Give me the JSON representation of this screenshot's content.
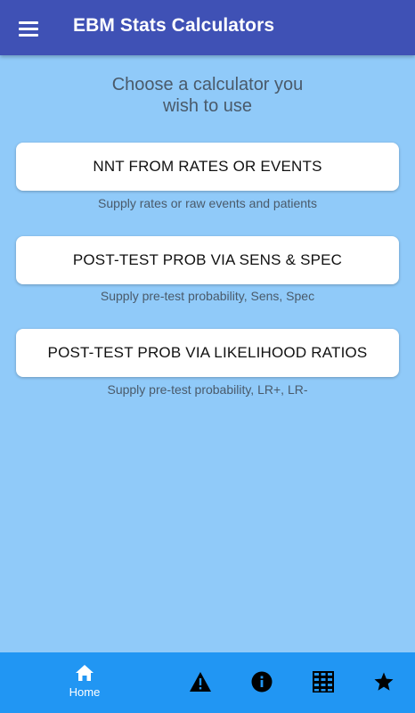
{
  "app_bar": {
    "title": "EBM Stats Calculators",
    "menu_icon": "hamburger-menu-icon",
    "background": "#3F51B5"
  },
  "main": {
    "background": "#90CAF9",
    "prompt_line1": "Choose a calculator you",
    "prompt_line2": "wish to use",
    "calculators": [
      {
        "label": "NNT FROM RATES OR EVENTS",
        "description": "Supply rates or raw events and patients"
      },
      {
        "label": "POST-TEST PROB VIA SENS & SPEC",
        "description": "Supply pre-test probability, Sens, Spec"
      },
      {
        "label": "POST-TEST PROB VIA LIKELIHOOD RATIOS",
        "description": "Supply pre-test probability, LR+, LR-"
      }
    ]
  },
  "bottom_nav": {
    "background": "#2196F3",
    "items": [
      {
        "icon": "home-icon",
        "label": "Home"
      },
      {
        "icon": "warning-icon"
      },
      {
        "icon": "info-icon"
      },
      {
        "icon": "abacus-icon"
      },
      {
        "icon": "star-icon"
      }
    ]
  }
}
